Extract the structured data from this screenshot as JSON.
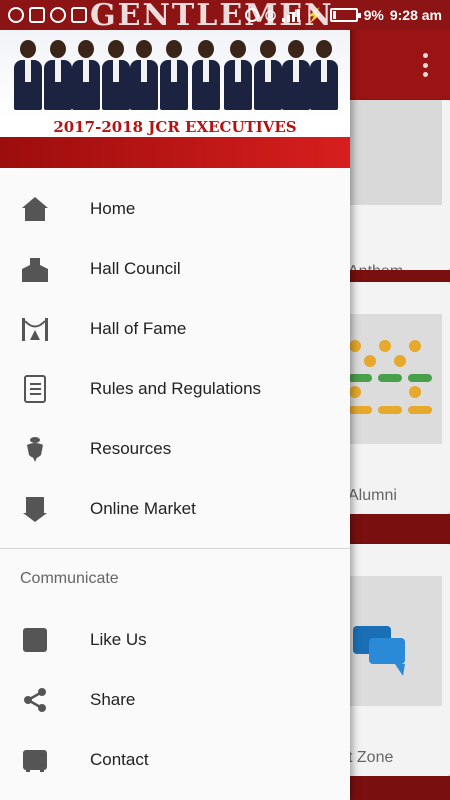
{
  "status_bar": {
    "overlay_text": "GENTLEMEN",
    "battery": "9%",
    "time": "9:28 am"
  },
  "header": {
    "banner": "2017-2018 JCR EXECUTIVES"
  },
  "background": {
    "card1_caption": "Anthem",
    "card2_caption": "Alumni",
    "card3_caption": "t Zone"
  },
  "menu": {
    "items": [
      {
        "label": "Home",
        "icon": "home-icon"
      },
      {
        "label": "Hall Council",
        "icon": "building-icon"
      },
      {
        "label": "Hall of Fame",
        "icon": "stage-icon"
      },
      {
        "label": "Rules and Regulations",
        "icon": "scroll-icon"
      },
      {
        "label": "Resources",
        "icon": "resource-icon"
      },
      {
        "label": "Online Market",
        "icon": "market-icon"
      }
    ],
    "section_title": "Communicate",
    "communicate": [
      {
        "label": "Like Us",
        "icon": "facebook-icon"
      },
      {
        "label": "Share",
        "icon": "share-icon"
      },
      {
        "label": "Contact",
        "icon": "contact-icon"
      }
    ]
  },
  "colors": {
    "primary": "#9b1414",
    "drawer_bg": "#fafafa",
    "banner_text": "#b51212",
    "icon": "#555555"
  }
}
